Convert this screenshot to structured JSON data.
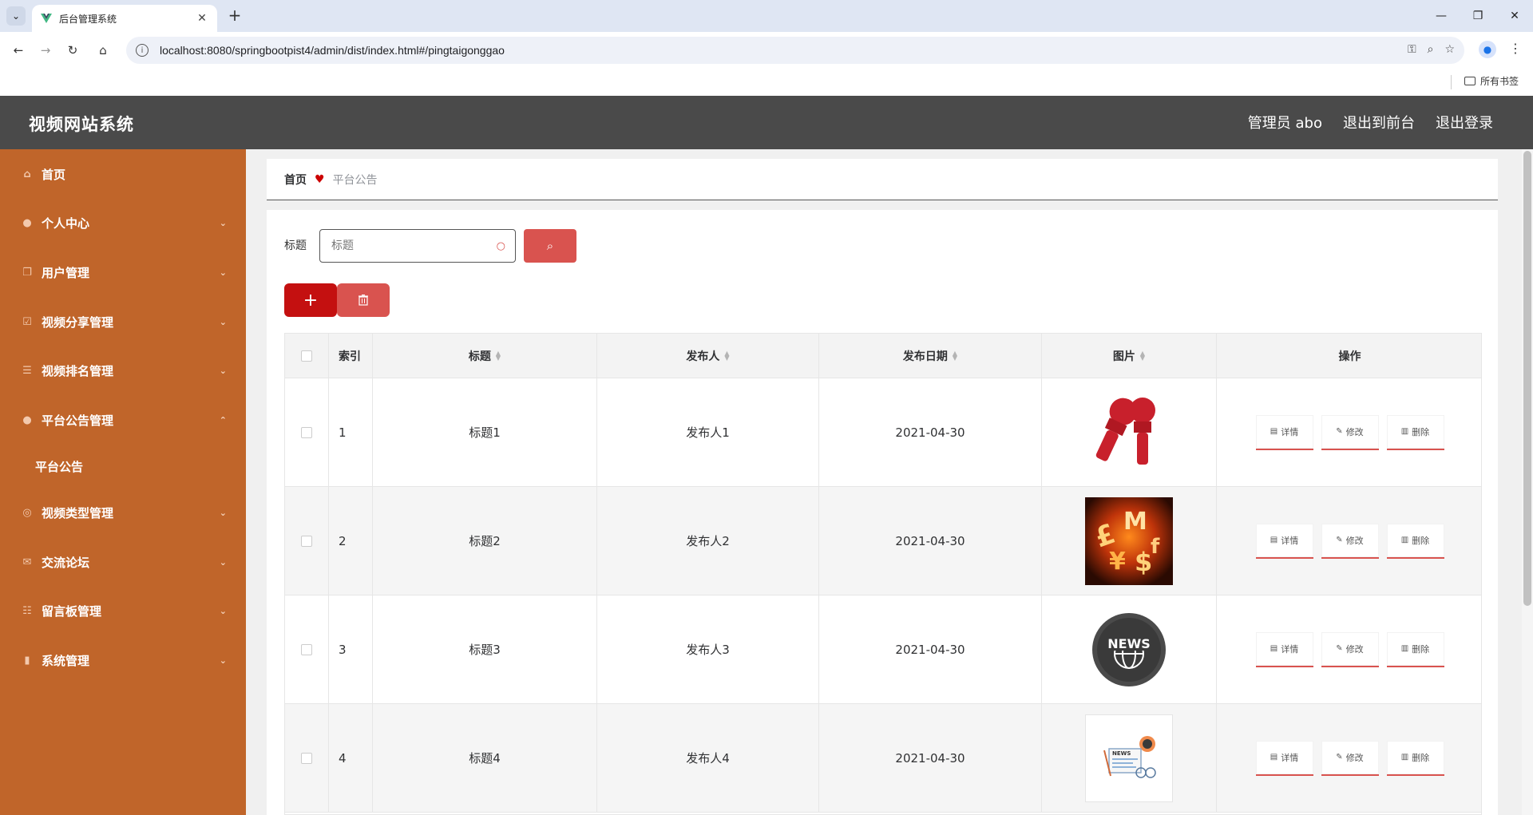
{
  "browser": {
    "tab_title": "后台管理系统",
    "url": "localhost:8080/springbootpist4/admin/dist/index.html#/pingtaigonggao",
    "bookmarks_all": "所有书签"
  },
  "header": {
    "title": "视频网站系统",
    "admin": "管理员 abo",
    "exit_front": "退出到前台",
    "logout": "退出登录"
  },
  "sidebar": {
    "items": [
      {
        "label": "首页",
        "icon": "home-icon",
        "has_arrow": false
      },
      {
        "label": "个人中心",
        "icon": "user-icon",
        "has_arrow": true,
        "arrow": "chevron-down"
      },
      {
        "label": "用户管理",
        "icon": "copy-icon",
        "has_arrow": true,
        "arrow": "chevron-down"
      },
      {
        "label": "视频分享管理",
        "icon": "check-square-icon",
        "has_arrow": true,
        "arrow": "chevron-down"
      },
      {
        "label": "视频排名管理",
        "icon": "list-icon",
        "has_arrow": true,
        "arrow": "chevron-down"
      },
      {
        "label": "平台公告管理",
        "icon": "location-icon",
        "has_arrow": true,
        "arrow": "chevron-up"
      },
      {
        "label": "视频类型管理",
        "icon": "target-icon",
        "has_arrow": true,
        "arrow": "chevron-down"
      },
      {
        "label": "交流论坛",
        "icon": "mail-icon",
        "has_arrow": true,
        "arrow": "chevron-down"
      },
      {
        "label": "留言板管理",
        "icon": "sliders-icon",
        "has_arrow": true,
        "arrow": "chevron-down"
      },
      {
        "label": "系统管理",
        "icon": "chart-icon",
        "has_arrow": true,
        "arrow": "chevron-down"
      }
    ],
    "submenu": {
      "label": "平台公告"
    }
  },
  "breadcrumb": {
    "home": "首页",
    "current": "平台公告"
  },
  "search": {
    "label": "标题",
    "placeholder": "标题"
  },
  "table": {
    "headers": [
      "索引",
      "标题",
      "发布人",
      "发布日期",
      "图片",
      "操作"
    ],
    "rows": [
      {
        "index": "1",
        "title": "标题1",
        "publisher": "发布人1",
        "date": "2021-04-30",
        "image": "news-microphones"
      },
      {
        "index": "2",
        "title": "标题2",
        "publisher": "发布人2",
        "date": "2021-04-30",
        "image": "currency-symbols"
      },
      {
        "index": "3",
        "title": "标题3",
        "publisher": "发布人3",
        "date": "2021-04-30",
        "image": "news-globe-badge"
      },
      {
        "index": "4",
        "title": "标题4",
        "publisher": "发布人4",
        "date": "2021-04-30",
        "image": "news-paper-icon"
      }
    ],
    "ops": {
      "detail": "详情",
      "edit": "修改",
      "delete": "删除"
    }
  },
  "colors": {
    "sidebar": "#c0652a",
    "header": "#4a4a4a",
    "accent": "#d9534f",
    "primary": "#c41010"
  }
}
